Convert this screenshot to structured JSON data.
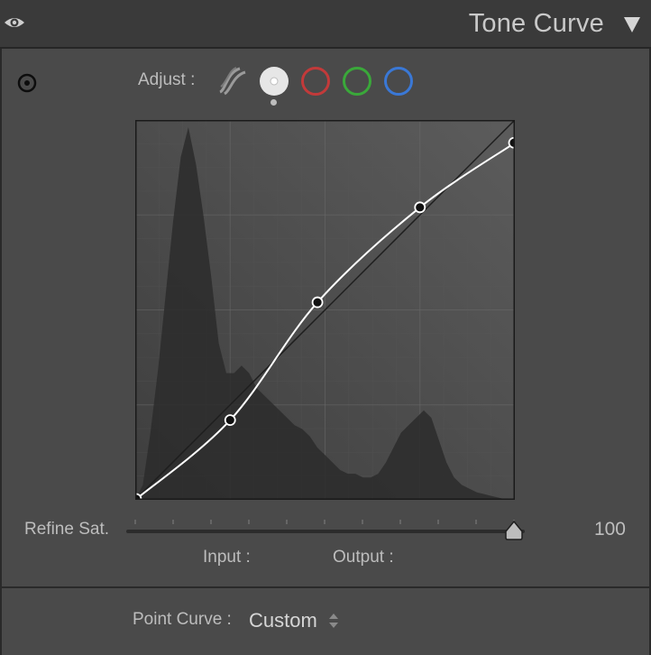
{
  "header": {
    "title": "Tone Curve",
    "visibility_icon": "eye-icon",
    "collapse_icon": "triangle-down-icon"
  },
  "adjust": {
    "label": "Adjust :",
    "channels": [
      {
        "name": "parametric",
        "icon": "parametric-curve-icon",
        "color": "#9a9a9a"
      },
      {
        "name": "rgb",
        "icon": "point-curve-rgb-icon",
        "color": "#e6e6e6",
        "selected": true
      },
      {
        "name": "red",
        "icon": "red-channel-icon",
        "color": "#c23a3a"
      },
      {
        "name": "green",
        "icon": "green-channel-icon",
        "color": "#3aa83a"
      },
      {
        "name": "blue",
        "icon": "blue-channel-icon",
        "color": "#3a78d6"
      }
    ]
  },
  "curve": {
    "points": [
      [
        0,
        0
      ],
      [
        25,
        21
      ],
      [
        48,
        52
      ],
      [
        75,
        77
      ],
      [
        100,
        94
      ]
    ],
    "histogram": [
      0,
      0.04,
      0.18,
      0.35,
      0.55,
      0.75,
      0.92,
      1,
      0.9,
      0.76,
      0.6,
      0.42,
      0.34,
      0.34,
      0.36,
      0.34,
      0.3,
      0.28,
      0.26,
      0.24,
      0.22,
      0.2,
      0.19,
      0.17,
      0.14,
      0.12,
      0.1,
      0.08,
      0.07,
      0.07,
      0.06,
      0.06,
      0.07,
      0.1,
      0.14,
      0.18,
      0.2,
      0.22,
      0.24,
      0.22,
      0.16,
      0.1,
      0.06,
      0.04,
      0.03,
      0.02,
      0.015,
      0.01,
      0.005,
      0,
      0
    ],
    "curve_color": "#ffffff"
  },
  "refine": {
    "label": "Refine Sat.",
    "value": "100",
    "slider_fraction": 1.0
  },
  "readout": {
    "input_label": "Input :",
    "output_label": "Output :"
  },
  "point_curve": {
    "label": "Point Curve :",
    "value": "Custom"
  }
}
